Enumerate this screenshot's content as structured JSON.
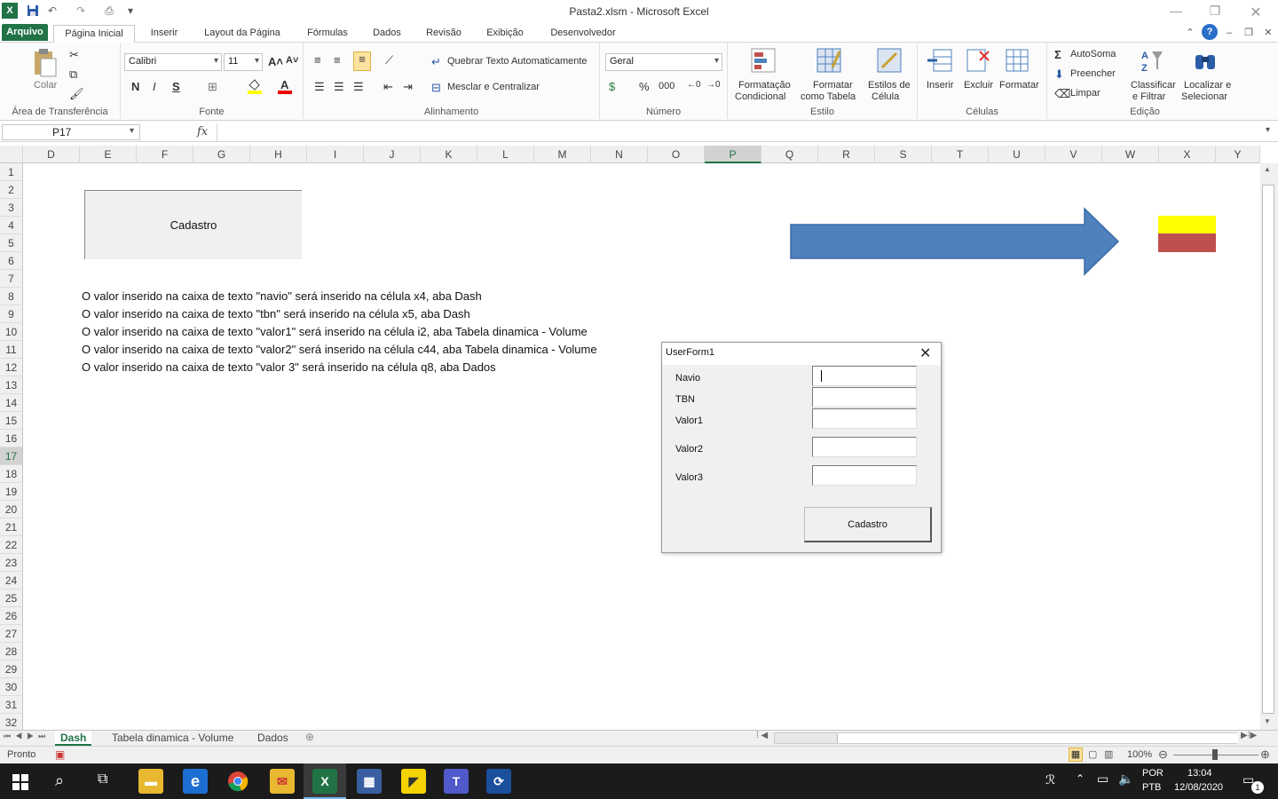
{
  "window": {
    "title": "Pasta2.xlsm  -  Microsoft Excel"
  },
  "ribbon_tabs": [
    "Arquivo",
    "Página Inicial",
    "Inserir",
    "Layout da Página",
    "Fórmulas",
    "Dados",
    "Revisão",
    "Exibição",
    "Desenvolvedor"
  ],
  "ribbon": {
    "clipboard": {
      "paste": "Colar",
      "label": "Área de Transferência"
    },
    "font": {
      "name": "Calibri",
      "size": "11",
      "bold": "N",
      "italic": "I",
      "underline": "S",
      "label": "Fonte"
    },
    "alignment": {
      "wrap": "Quebrar Texto Automaticamente",
      "merge": "Mesclar e Centralizar",
      "label": "Alinhamento"
    },
    "number": {
      "format": "Geral",
      "percent": "%",
      "thousands": "000",
      "label": "Número"
    },
    "styles": {
      "cond1": "Formatação",
      "cond2": "Condicional",
      "table1": "Formatar",
      "table2": "como Tabela",
      "cell1": "Estilos de",
      "cell2": "Célula",
      "label": "Estilo"
    },
    "cells": {
      "insert": "Inserir",
      "delete": "Excluir",
      "format": "Formatar",
      "label": "Células"
    },
    "editing": {
      "autosum": "AutoSoma",
      "fill": "Preencher",
      "clear": "Limpar",
      "sort1": "Classificar",
      "sort2": "e Filtrar",
      "find1": "Localizar e",
      "find2": "Selecionar",
      "label": "Edição"
    }
  },
  "formula_bar": {
    "namebox": "P17",
    "fx": "fx",
    "value": ""
  },
  "columns": [
    "D",
    "E",
    "F",
    "G",
    "H",
    "I",
    "J",
    "K",
    "L",
    "M",
    "N",
    "O",
    "P",
    "Q",
    "R",
    "S",
    "T",
    "U",
    "V",
    "W",
    "X",
    "Y"
  ],
  "selected_column": "P",
  "rows": [
    "1",
    "2",
    "3",
    "4",
    "5",
    "6",
    "7",
    "8",
    "9",
    "10",
    "11",
    "12",
    "13",
    "14",
    "15",
    "16",
    "17",
    "18",
    "19",
    "20",
    "21",
    "22",
    "23",
    "24",
    "25",
    "26",
    "27",
    "28",
    "29",
    "30",
    "31",
    "32"
  ],
  "selected_row": "17",
  "sheet": {
    "button_label": "Cadastro",
    "lines": [
      "O valor inserido na caixa de texto \"navio\" será inserido na célula x4, aba Dash",
      "O valor inserido na caixa de texto \"tbn\" será inserido na célula x5, aba Dash",
      "O valor inserido na caixa de texto \"valor1\" será inserido na célula i2, aba Tabela dinamica - Volume",
      "O valor inserido na caixa de texto \"valor2\" será inserido na célula c44, aba Tabela dinamica - Volume",
      "O valor inserido na caixa de texto \"valor 3\" será inserido na célula q8, aba Dados"
    ],
    "arrow_color": "#4f81bd",
    "flag_colors": [
      "#ffff00",
      "#c0504d"
    ]
  },
  "userform": {
    "title": "UserForm1",
    "fields": [
      {
        "label": "Navio",
        "value": ""
      },
      {
        "label": "TBN",
        "value": ""
      },
      {
        "label": "Valor1",
        "value": ""
      },
      {
        "label": "Valor2",
        "value": ""
      },
      {
        "label": "Valor3",
        "value": ""
      }
    ],
    "button": "Cadastro"
  },
  "sheet_tabs": [
    "Dash",
    "Tabela dinamica - Volume",
    "Dados"
  ],
  "active_sheet": "Dash",
  "status": {
    "mode": "Pronto",
    "zoom": "100%"
  },
  "taskbar": {
    "lang1": "POR",
    "lang2": "PTB",
    "time": "13:04",
    "date": "12/08/2020",
    "notifications": "1"
  }
}
